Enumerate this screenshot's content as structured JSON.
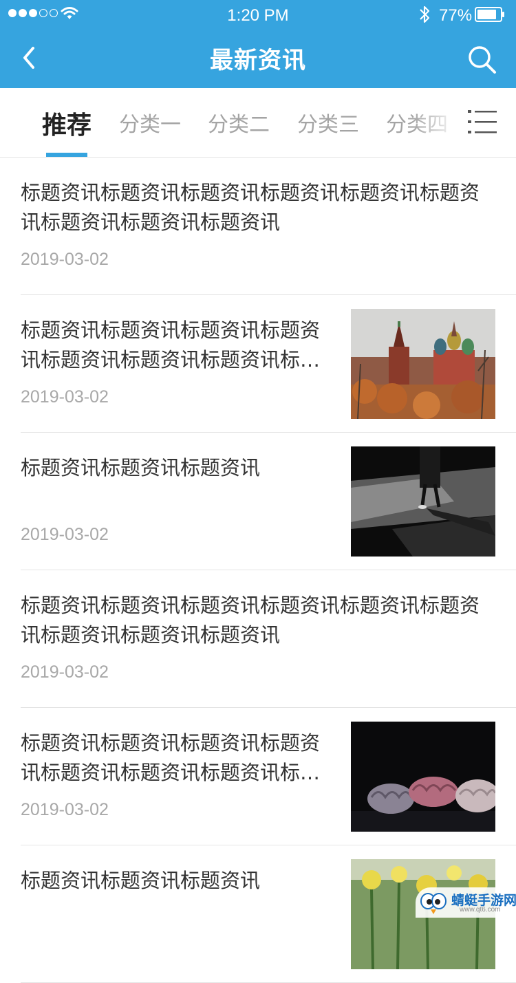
{
  "status_bar": {
    "time": "1:20 PM",
    "battery": "77%"
  },
  "header": {
    "title": "最新资讯"
  },
  "tabs": [
    {
      "label": "推荐",
      "active": true
    },
    {
      "label": "分类一"
    },
    {
      "label": "分类二"
    },
    {
      "label": "分类三"
    },
    {
      "label": "分类四"
    }
  ],
  "news": [
    {
      "title": "标题资讯标题资讯标题资讯标题资讯标题资讯标题资讯标题资讯标题资讯标题资讯",
      "date": "2019-03-02",
      "thumb": null
    },
    {
      "title": "标题资讯标题资讯标题资讯标题资讯标题资讯标题资讯标题资讯标题资讯",
      "date": "2019-03-02",
      "thumb": "kremlin-photo"
    },
    {
      "title": "标题资讯标题资讯标题资讯",
      "date": "2019-03-02",
      "thumb": "shadow-walker-photo"
    },
    {
      "title": "标题资讯标题资讯标题资讯标题资讯标题资讯标题资讯标题资讯标题资讯标题资讯",
      "date": "2019-03-02",
      "thumb": null
    },
    {
      "title": "标题资讯标题资讯标题资讯标题资讯标题资讯标题资讯标题资讯标题资讯",
      "date": "2019-03-02",
      "thumb": "pastries-photo"
    },
    {
      "title": "标题资讯标题资讯标题资讯",
      "date": "",
      "thumb": "flowers-photo"
    }
  ],
  "watermark": {
    "brand": "蜻蜓手游网",
    "url": "www.qt6.com"
  },
  "colors": {
    "primary": "#36a4df",
    "title_text": "#333333",
    "date_text": "#a8a8a8"
  }
}
